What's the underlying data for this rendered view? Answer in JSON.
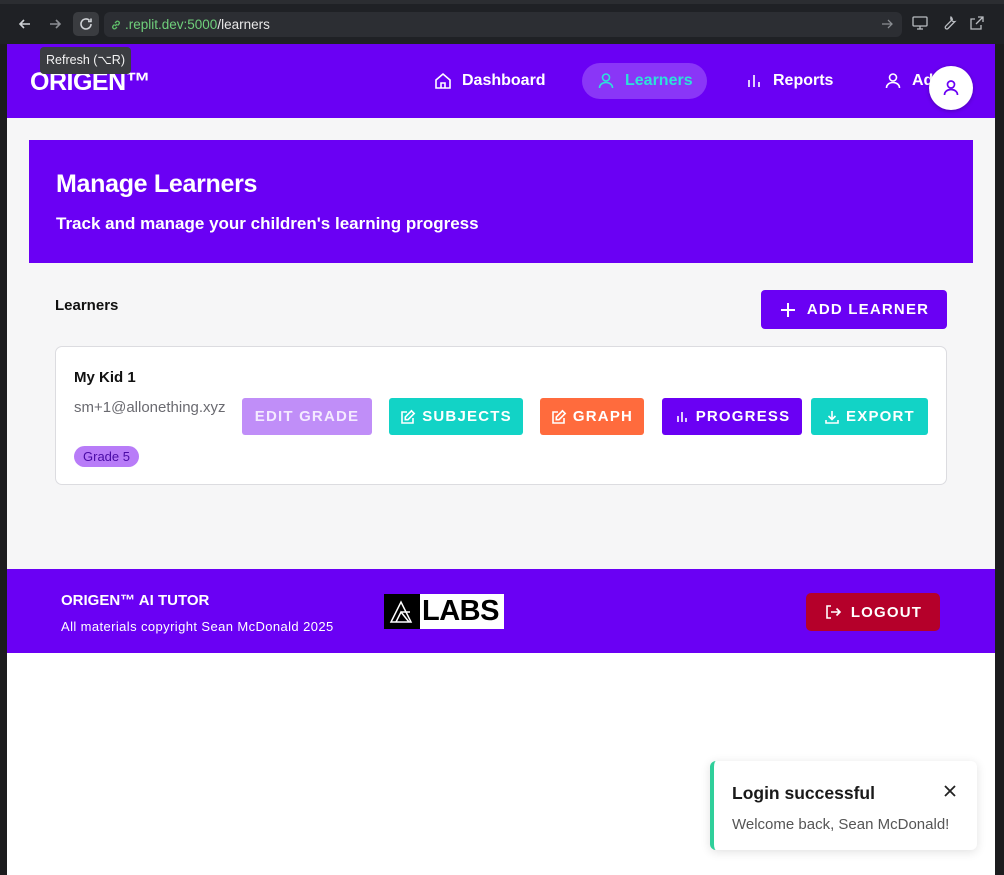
{
  "browser": {
    "url_host": ".replit.dev:5000",
    "url_path": "/learners",
    "tooltip": "Refresh (⌥R)"
  },
  "header": {
    "logo": "ORIGEN™",
    "nav": [
      {
        "label": "Dashboard",
        "icon": "home-icon"
      },
      {
        "label": "Learners",
        "icon": "user-icon",
        "active": true
      },
      {
        "label": "Reports",
        "icon": "bar-chart-icon"
      },
      {
        "label": "Ad",
        "icon": "user-icon"
      }
    ]
  },
  "hero": {
    "title": "Manage Learners",
    "subtitle": "Track and manage your children's learning progress"
  },
  "learners_section": {
    "title": "Learners",
    "add_button": "ADD LEARNER"
  },
  "learner_card": {
    "name": "My Kid 1",
    "email": "sm+1@allonething.xyz",
    "grade": "Grade 5",
    "actions": {
      "edit_grade": "EDIT GRADE",
      "subjects": "SUBJECTS",
      "graph": "GRAPH",
      "progress": "PROGRESS",
      "export": "EXPORT"
    }
  },
  "footer": {
    "title": "ORIGEN™ AI TUTOR",
    "copyright": "All materials copyright Sean McDonald 2025",
    "logo_text": "LABS",
    "logout": "LOGOUT"
  },
  "toast": {
    "title": "Login successful",
    "message": "Welcome back, Sean McDonald!"
  },
  "colors": {
    "brand_purple": "#6a00f4",
    "active_cyan": "#2de0d9",
    "edit_grade": "#c08ef8",
    "subjects": "#12d3c6",
    "graph": "#ff6b3d",
    "progress": "#6a00f4",
    "export": "#12d3c6",
    "logout": "#b5002a",
    "toast_accent": "#2fcf9a"
  }
}
